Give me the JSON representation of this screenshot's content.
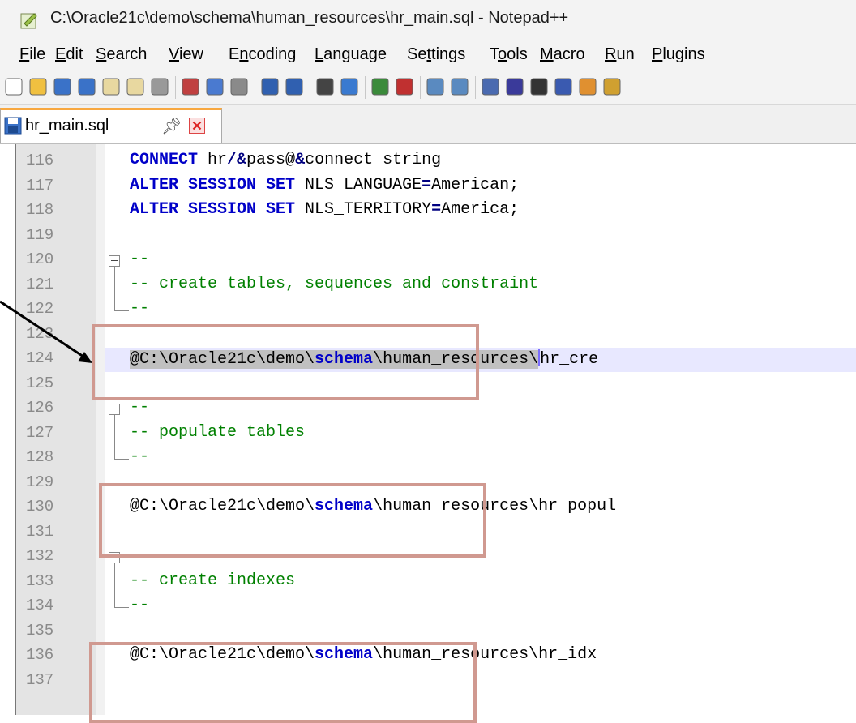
{
  "window": {
    "title": "C:\\Oracle21c\\demo\\schema\\human_resources\\hr_main.sql - Notepad++"
  },
  "menu": [
    {
      "accel": "F",
      "rest": "ile"
    },
    {
      "accel": "E",
      "rest": "dit"
    },
    {
      "accel": "S",
      "rest": "earch"
    },
    {
      "accel": "V",
      "rest": "iew"
    },
    {
      "pre": "E",
      "accel": "n",
      "rest": "coding"
    },
    {
      "accel": "L",
      "rest": "anguage"
    },
    {
      "pre": "Se",
      "accel": "t",
      "rest": "tings"
    },
    {
      "pre": "T",
      "accel": "o",
      "rest": "ols"
    },
    {
      "accel": "M",
      "rest": "acro"
    },
    {
      "accel": "R",
      "rest": "un"
    },
    {
      "accel": "P",
      "rest": "lugins"
    }
  ],
  "toolbar": {
    "icons": [
      "new-file-icon",
      "open-file-icon",
      "save-icon",
      "save-all-icon",
      "close-icon",
      "close-all-icon",
      "print-icon",
      "cut-icon",
      "copy-icon",
      "paste-icon",
      "undo-icon",
      "redo-icon",
      "find-icon",
      "replace-icon",
      "zoom-in-icon",
      "zoom-out-icon",
      "sync-vertical-icon",
      "sync-horizontal-icon",
      "word-wrap-icon",
      "show-all-chars-icon",
      "dropdown-icon",
      "indent-guide-icon",
      "user-lang-icon",
      "doc-map-icon"
    ]
  },
  "tab": {
    "label": "hr_main.sql",
    "pin": "♲"
  },
  "editor": {
    "lines": [
      {
        "n": "116",
        "segs": [
          {
            "t": "CONNECT",
            "c": "kw"
          },
          {
            "t": " hr"
          },
          {
            "t": "/&",
            "c": "op"
          },
          {
            "t": "pass@"
          },
          {
            "t": "&",
            "c": "op"
          },
          {
            "t": "connect_string"
          }
        ]
      },
      {
        "n": "117",
        "segs": [
          {
            "t": "ALTER SESSION SET",
            "c": "kw"
          },
          {
            "t": " NLS_LANGUAGE"
          },
          {
            "t": "=",
            "c": "op"
          },
          {
            "t": "American;"
          }
        ]
      },
      {
        "n": "118",
        "segs": [
          {
            "t": "ALTER SESSION SET",
            "c": "kw"
          },
          {
            "t": " NLS_TERRITORY"
          },
          {
            "t": "=",
            "c": "op"
          },
          {
            "t": "America;"
          }
        ]
      },
      {
        "n": "119",
        "segs": []
      },
      {
        "n": "120",
        "segs": [
          {
            "t": "--",
            "c": "cmt"
          }
        ]
      },
      {
        "n": "121",
        "segs": [
          {
            "t": "-- create tables, sequences and constraint",
            "c": "cmt"
          }
        ]
      },
      {
        "n": "122",
        "segs": [
          {
            "t": "--",
            "c": "cmt"
          }
        ]
      },
      {
        "n": "123",
        "segs": []
      },
      {
        "n": "124",
        "segs": [
          {
            "t": "@C:\\Oracle21c\\demo\\",
            "c": "sel"
          },
          {
            "t": "schema",
            "c": "kw sel"
          },
          {
            "t": "\\human_resources\\",
            "c": "sel"
          },
          {
            "t": "|",
            "c": "caret"
          },
          {
            "t": "hr_cre"
          }
        ]
      },
      {
        "n": "125",
        "segs": []
      },
      {
        "n": "126",
        "segs": [
          {
            "t": "--",
            "c": "cmt"
          }
        ]
      },
      {
        "n": "127",
        "segs": [
          {
            "t": "-- populate tables",
            "c": "cmt"
          }
        ]
      },
      {
        "n": "128",
        "segs": [
          {
            "t": "--",
            "c": "cmt"
          }
        ]
      },
      {
        "n": "129",
        "segs": []
      },
      {
        "n": "130",
        "segs": [
          {
            "t": "@C:\\Oracle21c\\demo\\"
          },
          {
            "t": "schema",
            "c": "kw"
          },
          {
            "t": "\\human_resources\\hr_popul"
          }
        ]
      },
      {
        "n": "131",
        "segs": []
      },
      {
        "n": "132",
        "segs": [
          {
            "t": "--",
            "c": "cmt"
          }
        ]
      },
      {
        "n": "133",
        "segs": [
          {
            "t": "-- create indexes",
            "c": "cmt"
          }
        ]
      },
      {
        "n": "134",
        "segs": [
          {
            "t": "--",
            "c": "cmt"
          }
        ]
      },
      {
        "n": "135",
        "segs": []
      },
      {
        "n": "136",
        "segs": [
          {
            "t": "@C:\\Oracle21c\\demo\\"
          },
          {
            "t": "schema",
            "c": "kw"
          },
          {
            "t": "\\human_resources\\hr_idx"
          }
        ]
      },
      {
        "n": "137",
        "segs": []
      }
    ],
    "current_line": "124",
    "fold_starts": [
      "120",
      "126",
      "132"
    ],
    "fold_ends": [
      "122",
      "128",
      "134"
    ]
  },
  "colors": {
    "callout": "#d09990",
    "arrow": "#000000",
    "keyword": "#0000c8",
    "comment": "#008000"
  }
}
